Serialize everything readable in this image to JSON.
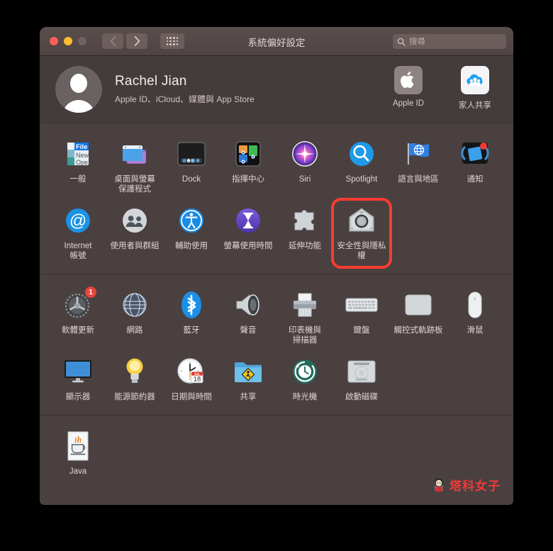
{
  "window": {
    "title": "系統偏好設定",
    "traffic_lights": [
      "close",
      "minimize",
      "zoom"
    ],
    "nav_back_icon": "chevron-left-icon",
    "nav_forward_icon": "chevron-right-icon",
    "grid_icon": "grid-view-icon",
    "search": {
      "placeholder": "搜尋",
      "value": "",
      "icon": "search-icon"
    }
  },
  "account": {
    "avatar_icon": "user-avatar-icon",
    "name": "Rachel Jian",
    "subtitle": "Apple ID、iCloud、媒體與 App Store",
    "actions": [
      {
        "label": "Apple ID",
        "icon": "apple-logo-icon"
      },
      {
        "label": "家人共享",
        "icon": "family-sharing-icon"
      }
    ]
  },
  "sections": [
    {
      "name": "personal",
      "items": [
        {
          "label": "一般",
          "icon": "general-icon"
        },
        {
          "label": "桌面與螢幕\n保護程式",
          "icon": "desktop-screensaver-icon"
        },
        {
          "label": "Dock",
          "icon": "dock-icon"
        },
        {
          "label": "指揮中心",
          "icon": "mission-control-icon"
        },
        {
          "label": "Siri",
          "icon": "siri-icon"
        },
        {
          "label": "Spotlight",
          "icon": "spotlight-icon"
        },
        {
          "label": "語言與地區",
          "icon": "language-region-icon"
        },
        {
          "label": "通知",
          "icon": "notifications-icon"
        },
        {
          "label": "Internet\n帳號",
          "icon": "internet-accounts-icon"
        },
        {
          "label": "使用者與群組",
          "icon": "users-groups-icon"
        },
        {
          "label": "輔助使用",
          "icon": "accessibility-icon"
        },
        {
          "label": "螢幕使用時間",
          "icon": "screen-time-icon"
        },
        {
          "label": "延伸功能",
          "icon": "extensions-icon"
        },
        {
          "label": "安全性與隱私權",
          "icon": "security-privacy-icon",
          "highlighted": true
        }
      ]
    },
    {
      "name": "hardware",
      "items": [
        {
          "label": "軟體更新",
          "icon": "software-update-icon",
          "badge": "1"
        },
        {
          "label": "網路",
          "icon": "network-icon"
        },
        {
          "label": "藍牙",
          "icon": "bluetooth-icon"
        },
        {
          "label": "聲音",
          "icon": "sound-icon"
        },
        {
          "label": "印表機與\n掃描器",
          "icon": "printers-scanners-icon"
        },
        {
          "label": "鍵盤",
          "icon": "keyboard-icon"
        },
        {
          "label": "觸控式軌跡板",
          "icon": "trackpad-icon"
        },
        {
          "label": "滑鼠",
          "icon": "mouse-icon"
        },
        {
          "label": "顯示器",
          "icon": "displays-icon"
        },
        {
          "label": "能源節約器",
          "icon": "energy-saver-icon"
        },
        {
          "label": "日期與時間",
          "icon": "date-time-icon"
        },
        {
          "label": "共享",
          "icon": "sharing-icon"
        },
        {
          "label": "時光機",
          "icon": "time-machine-icon"
        },
        {
          "label": "啟動磁碟",
          "icon": "startup-disk-icon"
        }
      ]
    },
    {
      "name": "other",
      "items": [
        {
          "label": "Java",
          "icon": "java-icon"
        }
      ]
    }
  ],
  "date_icon": {
    "month": "JUL",
    "day": "18"
  },
  "watermark": {
    "text": "塔科女子",
    "color": "#ef3a3a"
  },
  "colors": {
    "window_bg": "#4a4040",
    "titlebar": "#554948",
    "accent_highlight": "#fa3c32",
    "badge_red": "#e8453c",
    "text_primary": "#ded6d4"
  }
}
